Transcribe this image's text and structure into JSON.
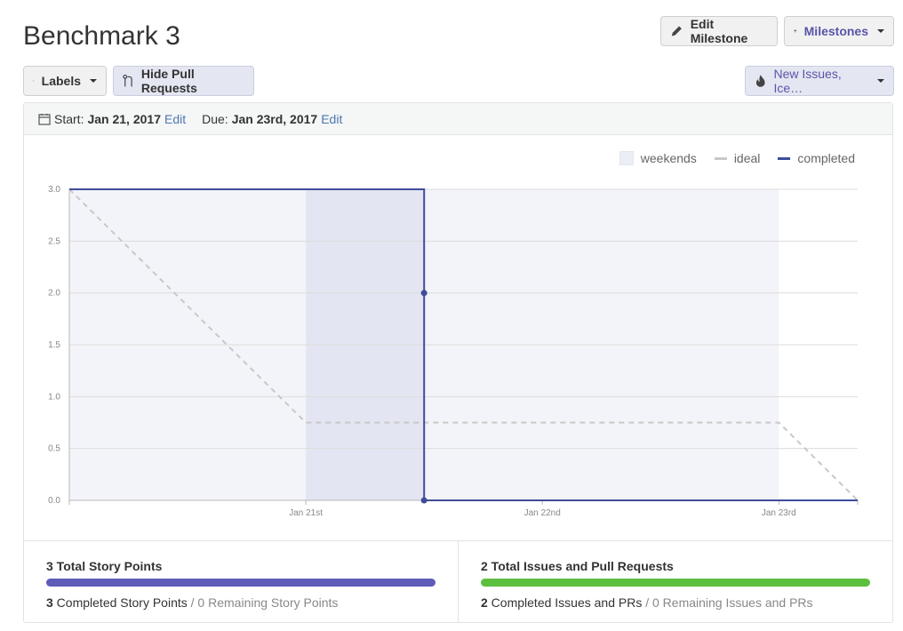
{
  "page": {
    "title": "Benchmark 3"
  },
  "toolbar": {
    "edit_milestone": "Edit Milestone",
    "milestones": "Milestones",
    "labels": "Labels",
    "hide_prs": "Hide Pull Requests",
    "filter": "New Issues, Ice…"
  },
  "dates": {
    "start_label": "Start:",
    "start_value": "Jan 21, 2017",
    "start_edit": "Edit",
    "due_label": "Due:",
    "due_value": "Jan 23rd, 2017",
    "due_edit": "Edit"
  },
  "legend": {
    "weekends": "weekends",
    "ideal": "ideal",
    "completed": "completed"
  },
  "colors": {
    "accent": "#5a54a8",
    "completed": "#3f4c9a",
    "ideal": "#c8c8c8",
    "weekend": "#eceef6",
    "progress_points": "#5f5bb8",
    "progress_issues": "#5dbf3e"
  },
  "chart_data": {
    "type": "line",
    "title": "",
    "xlabel": "",
    "ylabel": "",
    "ylim": [
      0,
      3
    ],
    "yticks": [
      "0.0",
      "0.5",
      "1.0",
      "1.5",
      "2.0",
      "2.5",
      "3.0"
    ],
    "xticks": [
      "Jan 21st",
      "Jan 22nd",
      "Jan 23rd"
    ],
    "grid": true,
    "legend_position": "top-right",
    "series": [
      {
        "name": "ideal",
        "style": "dashed",
        "points": [
          [
            "Jan 20, 2017",
            3.0
          ],
          [
            "Jan 21, 2017",
            0.75
          ],
          [
            "Jan 23, 2017",
            0.75
          ],
          [
            "Jan 23, 2017 08:00",
            0.0
          ]
        ]
      },
      {
        "name": "completed",
        "style": "solid",
        "points": [
          [
            "Jan 20, 2017",
            3.0
          ],
          [
            "Jan 21, 2017 12:00",
            3.0
          ],
          [
            "Jan 21, 2017 12:00",
            2.0
          ],
          [
            "Jan 21, 2017 12:00",
            0.0
          ],
          [
            "Jan 23, 2017 08:00",
            0.0
          ]
        ]
      }
    ],
    "weekends": [
      {
        "from": "Jan 20, 2017",
        "to": "Jan 21, 2017",
        "shade": "light"
      },
      {
        "from": "Jan 21, 2017",
        "to": "Jan 21, 2017 12:00",
        "shade": "dark"
      },
      {
        "from": "Jan 21, 2017 12:00",
        "to": "Jan 23, 2017",
        "shade": "light"
      }
    ]
  },
  "stats": {
    "points_title": "3 Total Story Points",
    "points_completed_num": "3",
    "points_completed_label": " Completed Story Points",
    "points_remaining": " / 0 Remaining Story Points",
    "points_progress": 1.0,
    "issues_title": "2 Total Issues and Pull Requests",
    "issues_completed_num": "2",
    "issues_completed_label": " Completed Issues and PRs",
    "issues_remaining": " / 0 Remaining Issues and PRs",
    "issues_progress": 1.0
  }
}
